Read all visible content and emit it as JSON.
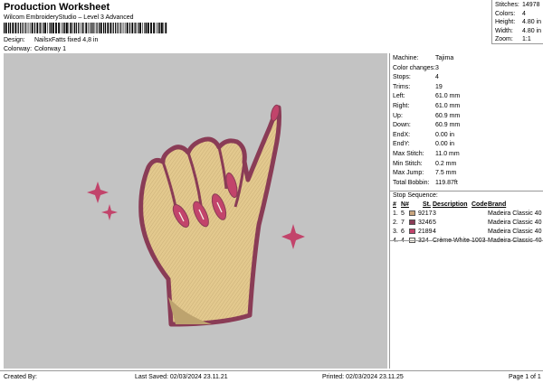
{
  "header": {
    "title": "Production Worksheet",
    "subtitle": "Wilcom EmbroideryStudio – Level 3 Advanced",
    "design_label": "Design:",
    "design_value": "NailsxFatts fixed 4,8 in",
    "colorway_label": "Colorway:",
    "colorway_value": "Colorway 1"
  },
  "stats": [
    {
      "label": "Stitches:",
      "value": "14978"
    },
    {
      "label": "Colors:",
      "value": "4"
    },
    {
      "label": "Height:",
      "value": "4.80 in"
    },
    {
      "label": "Width:",
      "value": "4.80 in"
    },
    {
      "label": "Zoom:",
      "value": "1:1"
    }
  ],
  "machine_info": [
    {
      "label": "Machine:",
      "value": "Tajima"
    },
    {
      "label": "Color changes:",
      "value": "3"
    },
    {
      "label": "Stops:",
      "value": "4"
    },
    {
      "label": "Trims:",
      "value": "19"
    },
    {
      "label": "Left:",
      "value": "61.0 mm"
    },
    {
      "label": "Right:",
      "value": "61.0 mm"
    },
    {
      "label": "Up:",
      "value": "60.9 mm"
    },
    {
      "label": "Down:",
      "value": "60.9 mm"
    },
    {
      "label": "EndX:",
      "value": "0.00 in"
    },
    {
      "label": "EndY:",
      "value": "0.00 in"
    },
    {
      "label": "Max Stitch:",
      "value": "11.0 mm"
    },
    {
      "label": "Min Stitch:",
      "value": "0.2 mm"
    },
    {
      "label": "Max Jump:",
      "value": "7.5 mm"
    },
    {
      "label": "Total Bobbin:",
      "value": "119.87ft"
    }
  ],
  "stop_sequence": {
    "title": "Stop Sequence:",
    "headers": {
      "num": "#",
      "n": "N#",
      "st": "St.",
      "desc": "Description",
      "code": "Code",
      "brand": "Brand"
    },
    "rows": [
      {
        "num": "1.",
        "n": "5",
        "color": "#c9a57e",
        "st": "9217",
        "desc": "3",
        "code": "",
        "brand": "Madeira Classic 40"
      },
      {
        "num": "2.",
        "n": "7",
        "color": "#8a3c56",
        "st": "3246",
        "desc": "5",
        "code": "",
        "brand": "Madeira Classic 40"
      },
      {
        "num": "3.",
        "n": "6",
        "color": "#c2446b",
        "st": "2189",
        "desc": "4",
        "code": "",
        "brand": "Madeira Classic 40"
      },
      {
        "num": "4.",
        "n": "4",
        "color": "#f4f0e4",
        "st": "324",
        "desc": "Crème White",
        "code": "1003",
        "brand": "Madeira Classic 40"
      }
    ]
  },
  "footer": {
    "created_by": "Created By:",
    "last_saved": "Last Saved: 02/03/2024 23.11.21",
    "printed": "Printed: 02/03/2024 23.11.25",
    "page": "Page 1 of 1"
  },
  "colors": {
    "canvas": "#c3c3c3",
    "skin": "#e3c98e",
    "outline": "#8a3c56",
    "nail": "#c2446b",
    "sparkle": "#c2446b"
  }
}
